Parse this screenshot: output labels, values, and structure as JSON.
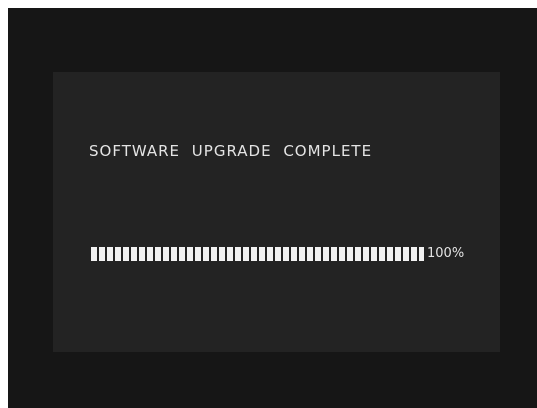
{
  "dialog": {
    "message": "SOFTWARE  UPGRADE  COMPLETE"
  },
  "progress": {
    "value": 1.0,
    "percent_label": "100%"
  },
  "colors": {
    "screen_background": "#161616",
    "dialog_background": "#232323",
    "text": "#e4e4e4",
    "bar_segment": "#f2f2f2"
  }
}
